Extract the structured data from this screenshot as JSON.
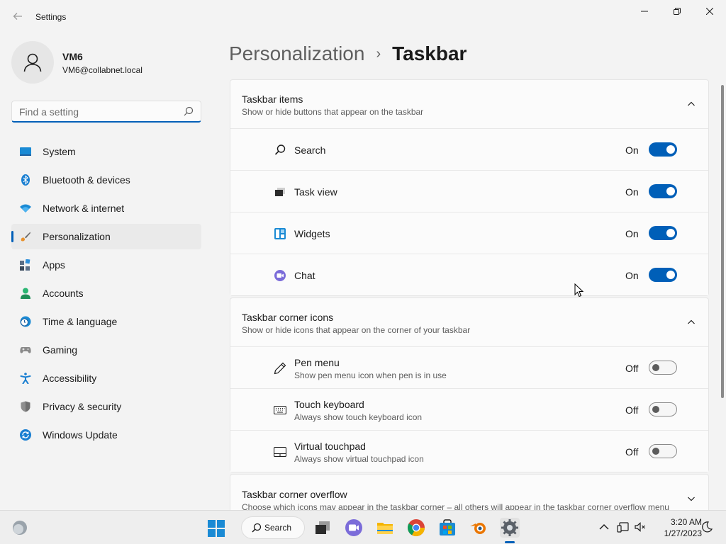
{
  "window": {
    "title": "Settings"
  },
  "profile": {
    "name": "VM6",
    "email": "VM6@collabnet.local"
  },
  "search": {
    "placeholder": "Find a setting"
  },
  "sidebar": {
    "items": [
      {
        "label": "System",
        "icon": "system-icon"
      },
      {
        "label": "Bluetooth & devices",
        "icon": "bluetooth-icon"
      },
      {
        "label": "Network & internet",
        "icon": "wifi-icon"
      },
      {
        "label": "Personalization",
        "icon": "brush-icon",
        "selected": true
      },
      {
        "label": "Apps",
        "icon": "apps-icon"
      },
      {
        "label": "Accounts",
        "icon": "accounts-icon"
      },
      {
        "label": "Time & language",
        "icon": "clock-globe-icon"
      },
      {
        "label": "Gaming",
        "icon": "controller-icon"
      },
      {
        "label": "Accessibility",
        "icon": "accessibility-icon"
      },
      {
        "label": "Privacy & security",
        "icon": "shield-icon"
      },
      {
        "label": "Windows Update",
        "icon": "update-icon"
      }
    ]
  },
  "breadcrumb": {
    "parent": "Personalization",
    "separator": "›",
    "current": "Taskbar"
  },
  "taskbar_items": {
    "title": "Taskbar items",
    "subtitle": "Show or hide buttons that appear on the taskbar",
    "rows": [
      {
        "label": "Search",
        "state": "On",
        "icon": "search-icon"
      },
      {
        "label": "Task view",
        "state": "On",
        "icon": "task-view-icon"
      },
      {
        "label": "Widgets",
        "state": "On",
        "icon": "widgets-icon"
      },
      {
        "label": "Chat",
        "state": "On",
        "icon": "chat-icon"
      }
    ]
  },
  "corner_icons": {
    "title": "Taskbar corner icons",
    "subtitle": "Show or hide icons that appear on the corner of your taskbar",
    "rows": [
      {
        "label": "Pen menu",
        "desc": "Show pen menu icon when pen is in use",
        "state": "Off",
        "icon": "pen-icon"
      },
      {
        "label": "Touch keyboard",
        "desc": "Always show touch keyboard icon",
        "state": "Off",
        "icon": "keyboard-icon"
      },
      {
        "label": "Virtual touchpad",
        "desc": "Always show virtual touchpad icon",
        "state": "Off",
        "icon": "touchpad-icon"
      }
    ]
  },
  "corner_overflow": {
    "title": "Taskbar corner overflow",
    "subtitle": "Choose which icons may appear in the taskbar corner – all others will appear in the taskbar corner overflow menu"
  },
  "taskbar": {
    "search_label": "Search",
    "time": "3:20 AM",
    "date": "1/27/2023"
  },
  "colors": {
    "accent": "#005fb8",
    "background": "#f3f3f3",
    "card": "#fbfbfb"
  }
}
